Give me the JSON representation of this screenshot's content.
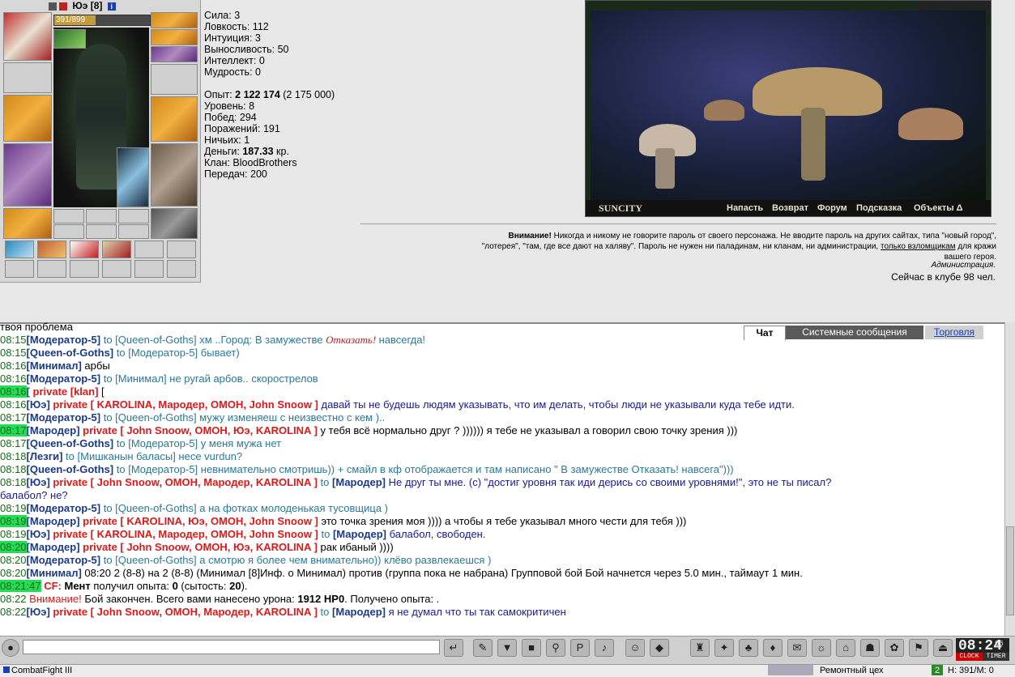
{
  "character": {
    "name": "Юэ",
    "level": "[8]",
    "info_icon": "i",
    "hp_text": "391/899",
    "hp_fraction": 0.435
  },
  "stats": {
    "strength": "Сила: 3",
    "agility": "Ловкость: 112",
    "intuition": "Интуиция: 3",
    "endurance": "Выносливость: 50",
    "intellect": "Интеллект: 0",
    "wisdom": "Мудрость: 0",
    "exp_label": "Опыт: ",
    "exp_value": "2 122 174",
    "exp_next": " (2 175 000)",
    "level": "Уровень: 8",
    "wins": "Побед: 294",
    "losses": "Поражений: 191",
    "draws": "Ничьих: 1",
    "money_label": "Деньги: ",
    "money_value": "187.33",
    "money_unit": " кр.",
    "clan": "Клан: BloodBrothers",
    "transfers": "Передач: 200"
  },
  "location": {
    "name": "SUNCITY",
    "buttons": [
      "Напасть",
      "Возврат",
      "Форум",
      "Подсказка",
      "Объекты Δ"
    ]
  },
  "warning": {
    "prefix": "Внимание!",
    "text1": " Никогда и никому не говорите пароль от своего персонажа. Не вводите пароль на других сайтах, типа \"новый город\",",
    "text2": "\"лотерея\", \"там, где все дают на халяву\". Пароль не нужен ни паладинам, ни кланам, ни администрации, ",
    "link": "только взломщикам",
    "text3": " для кражи",
    "text4": "вашего героя.",
    "admin": "Администрация.",
    "online": "Сейчас в клубе 98 чел."
  },
  "chat": {
    "tabs": [
      "Чат",
      "Системные сообщения",
      "Торговля"
    ],
    "first_line": "твоя проблема",
    "lines": [
      {
        "time": "08:15",
        "nick": "[Модератор-5]",
        "to": " to [Queen-of-Goths]",
        "msg": " хм ..Город: В замужестве ",
        "extra": "Отказать!",
        "msg2": " навсегда!"
      },
      {
        "time": "08:15",
        "nick": "[Queen-of-Goths]",
        "to": " to [Модератор-5]",
        "msg": " бывает)"
      },
      {
        "time": "08:16",
        "nick": "[Минимал]",
        "msg_pub": " арбы"
      },
      {
        "time": "08:16",
        "nick": "[Модератор-5]",
        "to": " to [Минимал]",
        "msg": " не ругай арбов.. скорострелов"
      },
      {
        "time": "08:16",
        "nick": "[",
        "pv": " private [klan] ",
        "msg_pub": "["
      },
      {
        "time": "08:16",
        "nick": "[Юэ]",
        "pv": " private [ KAROLINA, Мародер, ОМОН, John Snoow ]",
        "msg_pv": " давай ты не будешь людям указывать, что им делать, чтобы люди не указывали куда тебе идти."
      },
      {
        "time": "08:17",
        "nick": "[Модератор-5]",
        "to": " to [Queen-of-Goths]",
        "msg": " мужу изменяеш с неизвестно с кем ).."
      },
      {
        "time": "08:17",
        "nick": "[Мародер]",
        "pv": " private [ John Snoow, ОМОН, Юэ, KAROLINA ]",
        "msg_pub": " у тебя всё нормально друг ? )))))) я тебе не указывал а говорил свою точку зрения )))"
      },
      {
        "time": "08:17",
        "nick": "[Queen-of-Goths]",
        "to": " to [Модератор-5]",
        "msg": " у меня мужа нет"
      },
      {
        "time": "08:18",
        "nick": "[Лезги]",
        "to": " to [Мишканын баласы]",
        "msg": " несе vurdun?"
      },
      {
        "time": "08:18",
        "nick": "[Queen-of-Goths]",
        "to": " to [Модератор-5]",
        "msg": " невнимательно смотришь)) + смайл в кф отображается и там написано \" В замужестве Отказать! навсега\")))"
      },
      {
        "time": "08:18",
        "nick": "[Юэ]",
        "pv": " private [ John Snoow, ОМОН, Мародер, KAROLINA ]",
        "to2": " to ",
        "nick2": "[Мародер]",
        "msg_pv": " Не друг ты мне. (с) \"достиг уровня так иди дерись со своими уровнями!\", это не ты писал?"
      },
      {
        "cont": "балабол? не?"
      },
      {
        "time": "08:19",
        "nick": "[Модератор-5]",
        "to": " to [Queen-of-Goths]",
        "msg": " а на фотках молоденькая тусовщица )"
      },
      {
        "time": "08:19",
        "nick": "[Мародер]",
        "pv": " private [ KAROLINA, Юэ, ОМОН, John Snoow ]",
        "msg_pub": " это точка зрения моя )))) а чтобы я тебе указывал много чести для тебя )))"
      },
      {
        "time": "08:19",
        "nick": "[Юэ]",
        "pv": " private [ KAROLINA, Мародер, ОМОН, John Snoow ]",
        "to2": " to ",
        "nick2": "[Мародер]",
        "msg_pv": " балабол, свободен."
      },
      {
        "time": "08:20",
        "nick": "[Мародер]",
        "pv": " private [ John Snoow, ОМОН, Юэ, KAROLINA ]",
        "msg_pub": " рак ибаный ))))"
      },
      {
        "time": "08:20",
        "nick": "[Модератор-5]",
        "to": " to [Queen-of-Goths]",
        "msg": " а смотрю я более чем внимательно)) клёво развлекаешся )"
      },
      {
        "time": "08:20",
        "nick": "[Минимал]",
        "msg_pub": " 08:20 2 (8-8) на 2 (8-8) (Минимал [8]Инф. о Минимал) против (группа пока не набрана) Групповой бой Бой начнется через 5.0 мин., таймаут 1 мин."
      },
      {
        "time": "08:21:47",
        "sys": " CF:",
        "bold": " Мент",
        "msg_pub": " получил опыта: ",
        "bold2": "0",
        "msg_pub2": " (сытость: ",
        "bold3": "20",
        "msg_pub3": ")."
      },
      {
        "time": "08:22",
        "red": " Внимание!",
        "msg_pub": " Бой закончен. Всего вами нанесено урона: ",
        "bold": "1912 HP",
        "msg_pub2": ". Получено опыта: ",
        "bold2": "0",
        "msg_pub3": "."
      },
      {
        "time": "08:22",
        "nick": "[Юэ]",
        "pv": " private [ John Snoow, ОМОН, Мародер, KAROLINA ]",
        "to2": " to ",
        "nick2": "[Мародер]",
        "msg_pv": " я не думал что ты так самокритичен"
      }
    ]
  },
  "input": {
    "value": ""
  },
  "clock": {
    "time": "08:24",
    "sec": "06",
    "left": "CLOCK",
    "right": "TIMER"
  },
  "status": {
    "app": "CombatFight III",
    "location": "Ремонтный цех",
    "hp": "H: 391/M: 0"
  }
}
